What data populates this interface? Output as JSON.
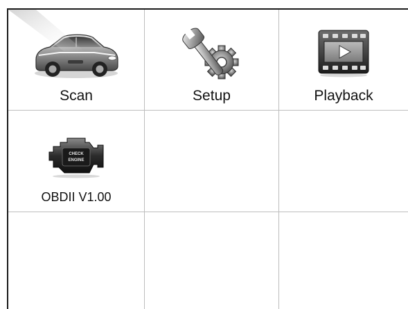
{
  "menu": {
    "tiles": [
      {
        "label": "Scan",
        "icon": "car-icon"
      },
      {
        "label": "Setup",
        "icon": "wrench-gear-icon"
      },
      {
        "label": "Playback",
        "icon": "film-play-icon"
      },
      {
        "label": "OBDII V1.00",
        "icon": "check-engine-icon",
        "icon_text": "CHECK ENGINE"
      },
      {
        "label": "",
        "icon": ""
      },
      {
        "label": "",
        "icon": ""
      },
      {
        "label": "",
        "icon": ""
      },
      {
        "label": "",
        "icon": ""
      },
      {
        "label": "",
        "icon": ""
      }
    ]
  }
}
